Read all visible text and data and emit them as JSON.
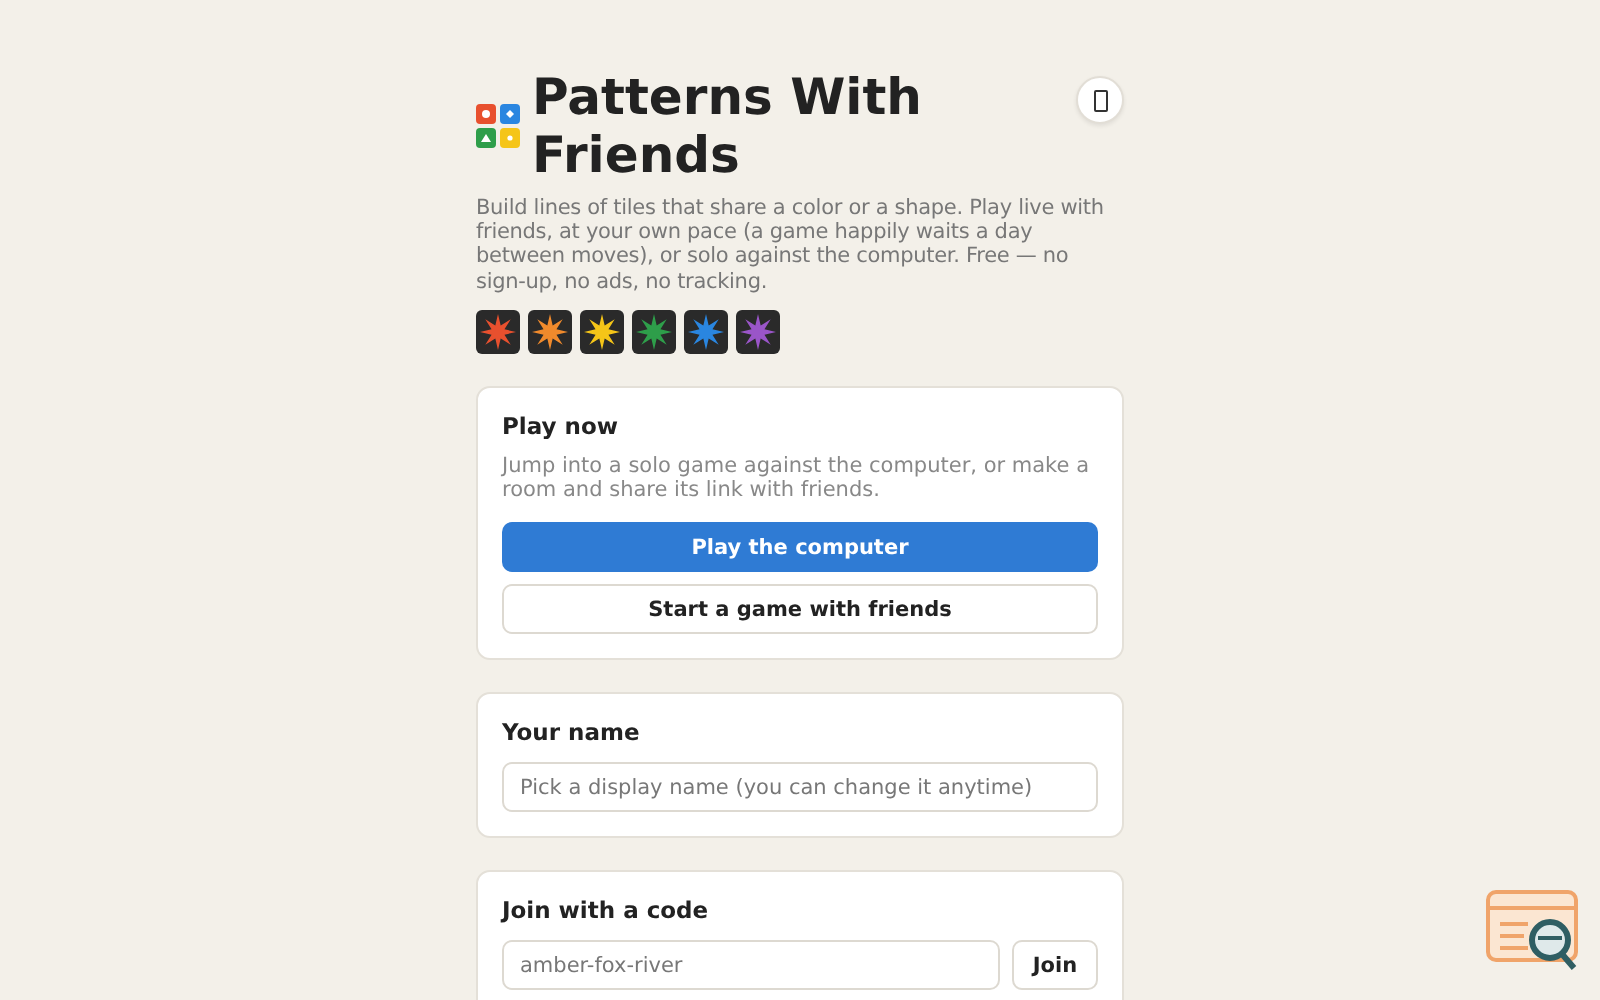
{
  "header": {
    "title": "Patterns With Friends",
    "description": "Build lines of tiles that share a color or a shape. Play live with friends, at your own pace (a game happily waits a day between moves), or solo against the computer. Free — no sign-up, no ads, no tracking."
  },
  "tiles": [
    {
      "color": "#e8502e"
    },
    {
      "color": "#f08a2c"
    },
    {
      "color": "#f5c518"
    },
    {
      "color": "#2e9e4a"
    },
    {
      "color": "#2a86e0"
    },
    {
      "color": "#9a55c8"
    }
  ],
  "play_card": {
    "title": "Play now",
    "text": "Jump into a solo game against the computer, or make a room and share its link with friends.",
    "primary_button": "Play the computer",
    "secondary_button": "Start a game with friends"
  },
  "name_card": {
    "title": "Your name",
    "placeholder": "Pick a display name (you can change it anytime)"
  },
  "join_card": {
    "title": "Join with a code",
    "placeholder": "amber-fox-river",
    "button": "Join"
  }
}
